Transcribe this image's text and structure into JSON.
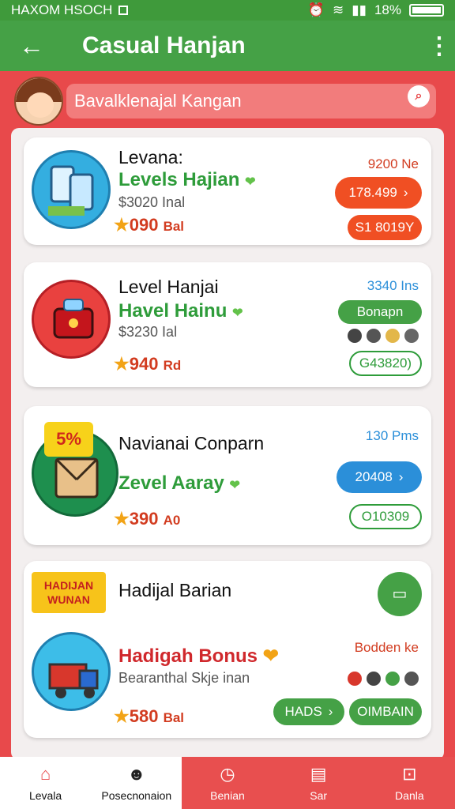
{
  "status_bar": {
    "left_text": "HAXOM HSOCH",
    "battery_percent": "18%"
  },
  "app_bar": {
    "back_label": "←",
    "title": "Casual Hanjan",
    "more_label": "⋮"
  },
  "search": {
    "value": "Bavalklenajal Kangan"
  },
  "cards": [
    {
      "title": "Levana:",
      "subtitle": "Levels Hajian",
      "info": "$3020 Inal",
      "rating": "090",
      "rating_unit": "Bal",
      "meta": "9200 Ne",
      "primary_button": "178.499",
      "secondary_button": "S1 8019Y"
    },
    {
      "title": "Level Hanjai",
      "subtitle": "Havel Hainu",
      "info": "$3230 Ial",
      "rating": "940",
      "rating_unit": "Rd",
      "meta": "3340 Ins",
      "primary_button": "Bonapn",
      "secondary_button": "G43820)"
    },
    {
      "title": "Navianai Conparn",
      "subtitle": "Zevel Aaray",
      "badge": "5%",
      "rating": "390",
      "rating_unit": "A0",
      "meta": "130 Pms",
      "primary_button": "20408",
      "secondary_button": "O10309"
    },
    {
      "title": "Hadijal Barian",
      "banner": "HADIJAN WUNAN",
      "subtitle": "Hadigah Bonus",
      "info": "Bearanthal Skje inan",
      "rating": "580",
      "rating_unit": "Bal",
      "meta": "Bodden ke",
      "primary_button": "HADS",
      "secondary_button": "OIMBAIN"
    }
  ],
  "bottom_nav": [
    {
      "label": "Levala"
    },
    {
      "label": "Posecnonaion"
    },
    {
      "label": "Benian"
    },
    {
      "label": "Sar"
    },
    {
      "label": "Danla"
    }
  ],
  "colors": {
    "green": "#45a146",
    "red": "#e8494b",
    "orange": "#f04f23",
    "blue": "#2b8fd9"
  },
  "icons": [
    "back-arrow-icon",
    "more-vert-icon",
    "search-icon",
    "star-icon",
    "heart-icon",
    "chevron-right-icon",
    "home-icon",
    "profile-icon",
    "timer-icon",
    "book-icon",
    "gift-icon"
  ]
}
